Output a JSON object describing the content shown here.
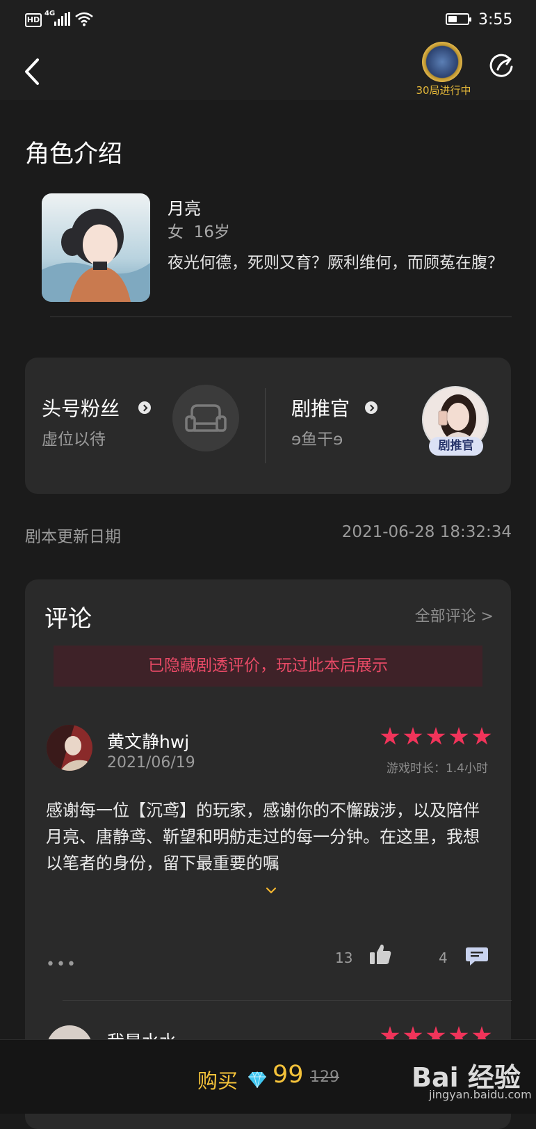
{
  "status_bar": {
    "hd": "HD",
    "network": "4G",
    "time": "3:55",
    "battery_level": 0.45
  },
  "nav": {
    "badge_label": "30局进行中"
  },
  "role_intro": {
    "section_title": "角色介绍",
    "name": "月亮",
    "meta": "女  16岁",
    "description": "夜光何德，死则又育？厥利维何，而顾菟在腹？"
  },
  "fans": {
    "top_fan_title": "头号粉丝",
    "top_fan_sub": "虚位以待",
    "recommender_title": "剧推官",
    "recommender_name": "ɘ鱼干ɘ",
    "recommender_badge": "剧推官"
  },
  "update": {
    "label": "剧本更新日期",
    "value": "2021-06-28 18:32:34"
  },
  "comments": {
    "title": "评论",
    "all_link": "全部评论 >",
    "spoiler_notice": "已隐藏剧透评价，玩过此本后展示",
    "items": [
      {
        "name": "黄文静hwj",
        "date": "2021/06/19",
        "rating": 5,
        "play_time": "游戏时长：1.4小时",
        "text": "感谢每一位【沉鸢】的玩家，感谢你的不懈跋涉，以及陪伴月亮、唐静鸢、靳望和明舫走过的每一分钟。在这里，我想以笔者的身份，留下最重要的嘱",
        "likes": "13",
        "replies": "4",
        "more": "•••"
      },
      {
        "name": "我是水水",
        "rating": 5
      }
    ]
  },
  "bottom": {
    "buy_label": "购买",
    "price": "99",
    "original_price": "129"
  },
  "watermark": {
    "brand": "Bai 经验",
    "url": "jingyan.baidu.com"
  },
  "colors": {
    "accent": "#f0345a",
    "gold": "#f4c23a",
    "background": "#1b1b1b",
    "card": "#2a2a2a"
  },
  "icons": [
    "back-arrow-icon",
    "share-icon",
    "armchair-icon",
    "thumbs-up-icon",
    "comment-icon",
    "diamond-icon",
    "star-icon",
    "chevron-down-icon"
  ]
}
